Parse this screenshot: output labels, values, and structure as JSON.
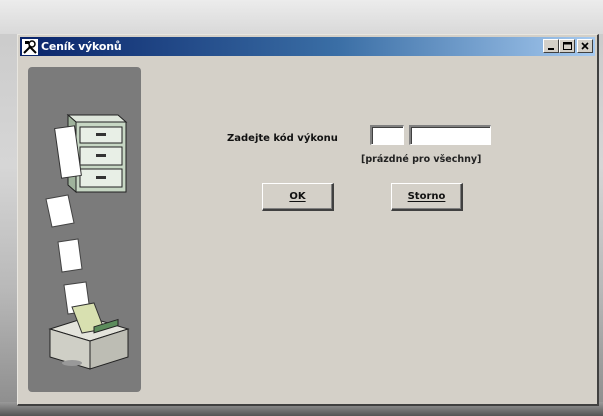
{
  "window": {
    "title": "Ceník výkonů",
    "minimize_icon": "minimize-icon",
    "maximize_icon": "maximize-icon",
    "close_icon": "close-icon",
    "app_icon": "tools-icon"
  },
  "side_panel": {
    "illustration": [
      "file-cabinet-icon",
      "paper-sheet-icon",
      "printer-icon"
    ]
  },
  "form": {
    "code_label": "Zadejte kód výkonu",
    "code_value_1": "",
    "code_value_2": "",
    "hint": "[prázdné pro všechny]"
  },
  "buttons": {
    "ok_label": "OK",
    "storno_label": "Storno"
  }
}
